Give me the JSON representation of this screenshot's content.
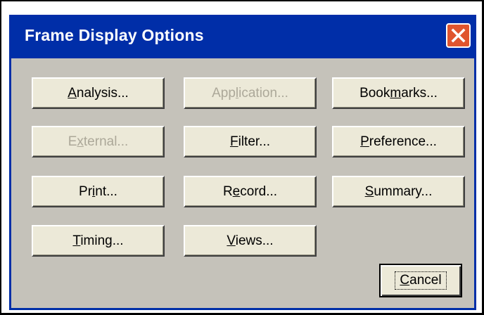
{
  "window": {
    "title": "Frame Display Options",
    "title_bar_color": "#002EA8",
    "close_icon": "close-x-icon",
    "close_button_color": "#E0552E"
  },
  "buttons": [
    {
      "id": "analysis",
      "label_pre": "",
      "label_ul": "A",
      "label_post": "nalysis...",
      "enabled": true
    },
    {
      "id": "application",
      "label_pre": "App",
      "label_ul": "l",
      "label_post": "ication...",
      "enabled": false
    },
    {
      "id": "bookmarks",
      "label_pre": "Book",
      "label_ul": "m",
      "label_post": "arks...",
      "enabled": true
    },
    {
      "id": "external",
      "label_pre": "E",
      "label_ul": "x",
      "label_post": "ternal...",
      "enabled": false
    },
    {
      "id": "filter",
      "label_pre": "",
      "label_ul": "F",
      "label_post": "ilter...",
      "enabled": true
    },
    {
      "id": "preference",
      "label_pre": "",
      "label_ul": "P",
      "label_post": "reference...",
      "enabled": true
    },
    {
      "id": "print",
      "label_pre": "Pr",
      "label_ul": "i",
      "label_post": "nt...",
      "enabled": true
    },
    {
      "id": "record",
      "label_pre": "R",
      "label_ul": "e",
      "label_post": "cord...",
      "enabled": true
    },
    {
      "id": "summary",
      "label_pre": "",
      "label_ul": "S",
      "label_post": "ummary...",
      "enabled": true
    },
    {
      "id": "timing",
      "label_pre": "",
      "label_ul": "T",
      "label_post": "iming...",
      "enabled": true
    },
    {
      "id": "views",
      "label_pre": "",
      "label_ul": "V",
      "label_post": "iews...",
      "enabled": true
    }
  ],
  "cancel": {
    "label_pre": "",
    "label_ul": "C",
    "label_post": "ancel"
  },
  "colors": {
    "dialog_face": "#ECE9D8",
    "client_background": "#C5C2BA",
    "disabled_text": "#ACA899"
  }
}
